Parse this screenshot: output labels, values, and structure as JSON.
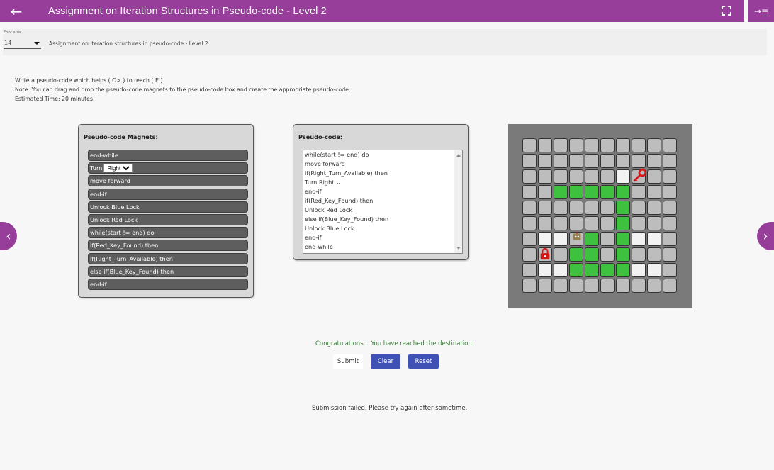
{
  "header": {
    "title": "Assignment on Iteration Structures in Pseudo-code - Level 2"
  },
  "toolbar": {
    "font_size_label": "Font size",
    "font_size_value": "14",
    "breadcrumb": "Assignment on iteration structures in pseudo-code - Level 2"
  },
  "instructions": {
    "line1": "Write a pseudo-code which helps ( O> ) to reach ( E ).",
    "line2": "Note: You can drag and drop the pseudo-code magnets to the pseudo-code box and create the appropriate pseudo-code.",
    "line3": "Estimated Time: 20 minutes"
  },
  "magnets_panel": {
    "title": "Pseudo-code Magnets:",
    "items": [
      "end-while",
      "Turn",
      "move forward",
      "end-if",
      "Unlock Blue Lock",
      "Unlock Red Lock",
      "while(start != end) do",
      "if(Red_Key_Found) then",
      "if(Right_Turn_Available) then",
      "else if(Blue_Key_Found) then",
      "end-if"
    ],
    "turn_option": "Right"
  },
  "code_panel": {
    "title": "Pseudo-code:",
    "lines": [
      "while(start != end) do",
      "move forward",
      "if(Right_Turn_Available) then",
      "Turn",
      "end-if",
      "if(Red_Key_Found) then",
      "Unlock Red Lock",
      "else if(Blue_Key_Found) then",
      "Unlock Blue Lock",
      "end-if",
      "end-while"
    ],
    "turn_option": "Right"
  },
  "maze": {
    "rows": [
      "..........",
      "..........",
      "......W...",
      "..GGGGG...",
      "......G...",
      "......G...",
      ".WW.G.GWW.",
      "...GG.G...",
      ".WWGGGGWW.",
      ".........."
    ],
    "key_icon": "red-key-icon",
    "lock_icon": "red-lock-icon",
    "robot_icon": "robot-icon"
  },
  "status": {
    "success": "Congratulations... You have reached the destination",
    "failed": "Submission failed. Please try again after sometime."
  },
  "buttons": {
    "submit": "Submit",
    "clear": "Clear",
    "reset": "Reset"
  },
  "colors": {
    "brand": "#973e9b",
    "primary_button": "#3f51b5",
    "path": "#3ec13e"
  }
}
